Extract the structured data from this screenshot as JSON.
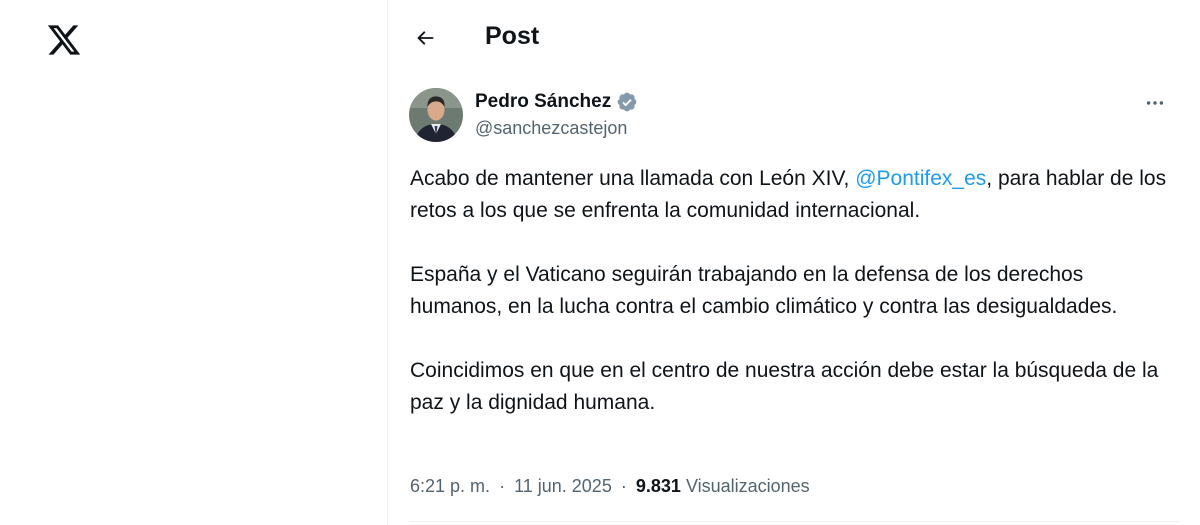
{
  "header": {
    "title": "Post"
  },
  "author": {
    "name": "Pedro Sánchez",
    "handle": "@sanchezcastejon",
    "verified": true
  },
  "tweet": {
    "p1_before": "Acabo de mantener una llamada con León XIV, ",
    "p1_mention": "@Pontifex_es",
    "p1_after": ", para hablar de los retos a los que se enfrenta la comunidad internacional.",
    "p2": "España y el Vaticano seguirán trabajando en la defensa de los derechos humanos, en la lucha contra el cambio climático y contra las desigualdades.",
    "p3": "Coincidimos en que en el centro de nuestra acción debe estar la búsqueda de la paz y la dignidad humana."
  },
  "meta": {
    "time": "6:21 p. m.",
    "separator": "·",
    "date": "11 jun. 2025",
    "views_count": "9.831",
    "views_label": "Visualizaciones"
  },
  "icons": {
    "logo": "x-logo-icon",
    "back": "back-arrow-icon",
    "verified": "verified-badge-icon",
    "more": "more-icon"
  },
  "colors": {
    "accent": "#1d9bf0",
    "text": "#0f1419",
    "secondary": "#536471",
    "verified_badge": "#829aab"
  }
}
